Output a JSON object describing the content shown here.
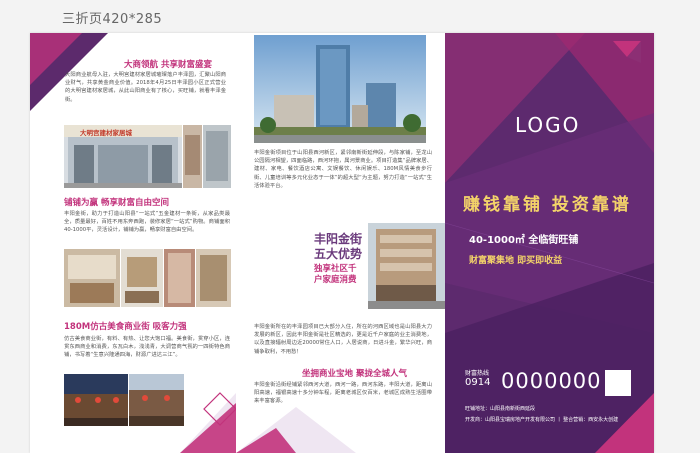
{
  "header_label": "三折页420*285",
  "panel1": {
    "s1_title": "大商领航  共享财富盛宴",
    "s1_body": "大阳商业航母入驻，大明宫建材家居城璀璨落户丰泽园，汇聚山阳商业财气，共享黄金商业价值。2018年4月25日丰泽园小区正式营业的大明宫建材家居城，从此山阳商业有了核心，买旺铺，就看丰泽金街。",
    "store_sign": "大明宫建材家居城",
    "s2_title": "铺铺为赢  畅享财富自由空间",
    "s2_body": "丰阳金街，助力于打造山阳县“一站式”五金建材一条街，从家品类最全，质量最好，百姓不用东奔西跑，装修家居“一站式”购物。商铺面积40-1000平，灵活设计，铺铺为赢，畅享财富自由空间。",
    "s3_title": "180M仿古美食商业街  吸客力强",
    "s3_body": "仿古美食商业街，有料、有热、让您大饱口福。美食街，贯穿小区，连贯东西商业和消费，东瓦白木，浅浅青，大调营商气氛的一四街特色商铺，书写着“生意兴隆通四海，财源广进达三江”。"
  },
  "panel2": {
    "body1": "丰阳金街项目位于山阳县西河新区，紧邻南新街延伸段，与陈家铺，至龙山公园隔河相望，四面临路，西河环抱，属河景商业。项目打造集“品牌家居、建材、家电、餐饮酒店公寓、文娱餐饮、休闲娱乐、180M风情美食步行街、儿童培训等多元化业态于一体”的超大型“为主题，努力打造“一站式”生活体验平台。",
    "adv_title_line1": "丰阳金街",
    "adv_title_line2": "五大优势",
    "adv_sub_line1": "独享社区千",
    "adv_sub_line2": "户家庭消费",
    "body2": "丰阳金街所在的丰泽园项目已大部分入住，所在的河西区域也是山阳县大力发展的新区，因此丰阳金街是社区精选的，更是近千户家庭的业主消费地，以及直接辐射周边近20000常住人口，人居说商，日进斗金，繁华兴旺，商铺争取利，不用愁！",
    "s_title": "坐拥商业宝地  聚拢全城人气",
    "body3": "丰阳金街沿街经铺紧邻西河大道，西河一路，西河东路，丰阳大道，距离山阳高速，福银高速十多分钟车程，距离老城区仅百米，老城区成熟生活圈带来丰富客源。"
  },
  "panel3": {
    "logo": "LOGO",
    "slogan": "赚钱靠铺 投资靠谱",
    "area_line": "40-1000㎡ 全临街旺铺",
    "wealth_line": "财富聚集地  即买即收益",
    "hotline_label": "财富热线",
    "area_code": "0914",
    "phone": "0000000",
    "address": "旺铺地址：山阳县南新街西延段",
    "developer": "开发商：山阳县宝瑞房地产开发有限公司  丨  整合营销：西安永大创建"
  },
  "colors": {
    "brand_purple": "#5d2a6e",
    "accent_pink": "#c2337c",
    "gold": "#f4d469"
  }
}
